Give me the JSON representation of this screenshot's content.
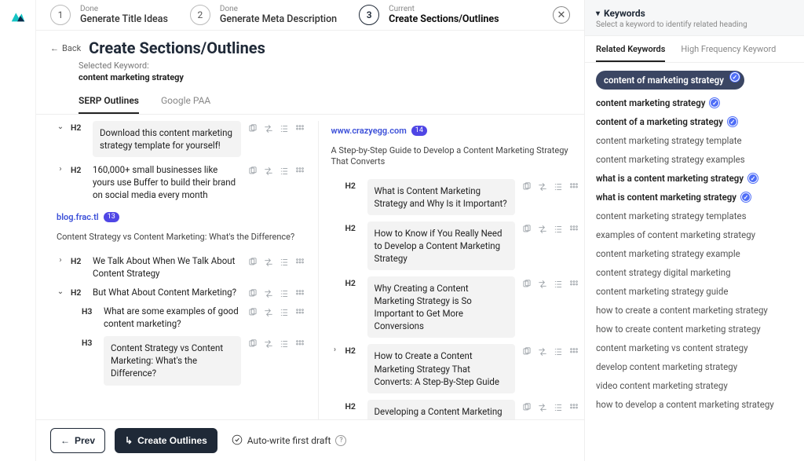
{
  "stepper": {
    "steps": [
      {
        "num": "1",
        "status": "Done",
        "title": "Generate Title Ideas"
      },
      {
        "num": "2",
        "status": "Done",
        "title": "Generate Meta Description"
      },
      {
        "num": "3",
        "status": "Current",
        "title": "Create Sections/Outlines"
      }
    ]
  },
  "header": {
    "back_label": "Back",
    "page_title": "Create Sections/Outlines",
    "selected_keyword_label": "Selected Keyword:",
    "selected_keyword_value": "content marketing strategy"
  },
  "tabs": {
    "items": [
      "SERP Outlines",
      "Google PAA"
    ],
    "active": 0
  },
  "left_col": {
    "top_items": [
      {
        "chev": "⌄",
        "tag": "H2",
        "text": "Download this content marketing strategy template for yourself!",
        "box": true
      },
      {
        "chev": "›",
        "tag": "H2",
        "text": "160,000+ small businesses like yours use Buffer to build their brand on social media every month",
        "box": false
      }
    ],
    "domain": {
      "url": "blog.frac.tl",
      "badge": "13",
      "subtitle": "Content Strategy vs Content Marketing: What's the Difference?"
    },
    "group_items": [
      {
        "chev": "›",
        "tag": "H2",
        "text": "We Talk About When We Talk About Content Strategy",
        "box": false
      },
      {
        "chev": "⌄",
        "tag": "H2",
        "text": "But What About Content Marketing?",
        "box": false
      },
      {
        "chev": "",
        "tag": "H3",
        "text": "What are some examples of good content marketing?",
        "box": false,
        "sub": true
      },
      {
        "chev": "",
        "tag": "H3",
        "text": "Content Strategy vs Content Marketing: What's the Difference?",
        "box": true,
        "sub": true
      }
    ]
  },
  "right_col": {
    "domain": {
      "url": "www.crazyegg.com",
      "badge": "14",
      "subtitle": "A Step-by-Step Guide to Develop a Content Marketing Strategy That Converts"
    },
    "items": [
      {
        "chev": "",
        "tag": "H2",
        "text": "What is Content Marketing Strategy and Why Is it Important?",
        "box": true
      },
      {
        "chev": "",
        "tag": "H2",
        "text": "How to Know if You Really Need to Develop a Content Marketing Strategy",
        "box": true
      },
      {
        "chev": "",
        "tag": "H2",
        "text": "Why Creating a Content Marketing Strategy is So Important to Get More Conversions",
        "box": true
      },
      {
        "chev": "›",
        "tag": "H2",
        "text": "How to Create a Content Marketing Strategy That Converts: A Step-By-Step Guide",
        "box": true
      },
      {
        "chev": "",
        "tag": "H2",
        "text": "Developing a Content Marketing Strategy: Checklist",
        "box": true
      }
    ]
  },
  "footer": {
    "prev_label": "Prev",
    "create_label": "Create Outlines",
    "autowrite_label": "Auto-write first draft"
  },
  "sidebar": {
    "title": "Keywords",
    "subtitle": "Select a keyword to identify related heading",
    "tabs": [
      "Related Keywords",
      "High Frequency Keyword"
    ],
    "active_tab": 0,
    "keywords": [
      {
        "label": "content of marketing strategy",
        "checked": true,
        "chip": true
      },
      {
        "label": "content marketing strategy",
        "checked": true,
        "chip": false
      },
      {
        "label": "content of a marketing strategy",
        "checked": true,
        "chip": false
      },
      {
        "label": "content marketing strategy template",
        "checked": false,
        "chip": false
      },
      {
        "label": "content marketing strategy examples",
        "checked": false,
        "chip": false
      },
      {
        "label": "what is a content marketing strategy",
        "checked": true,
        "chip": false
      },
      {
        "label": "what is content marketing strategy",
        "checked": true,
        "chip": false
      },
      {
        "label": "content marketing strategy templates",
        "checked": false,
        "chip": false
      },
      {
        "label": "examples of content marketing strategy",
        "checked": false,
        "chip": false
      },
      {
        "label": "content marketing strategy example",
        "checked": false,
        "chip": false
      },
      {
        "label": "content strategy digital marketing",
        "checked": false,
        "chip": false
      },
      {
        "label": "content marketing strategy guide",
        "checked": false,
        "chip": false
      },
      {
        "label": "how to create a content marketing strategy",
        "checked": false,
        "chip": false
      },
      {
        "label": "how to create content marketing strategy",
        "checked": false,
        "chip": false
      },
      {
        "label": "content marketing vs content strategy",
        "checked": false,
        "chip": false
      },
      {
        "label": "develop content marketing strategy",
        "checked": false,
        "chip": false
      },
      {
        "label": "video content marketing strategy",
        "checked": false,
        "chip": false
      },
      {
        "label": "how to develop a content marketing strategy",
        "checked": false,
        "chip": false
      }
    ]
  }
}
